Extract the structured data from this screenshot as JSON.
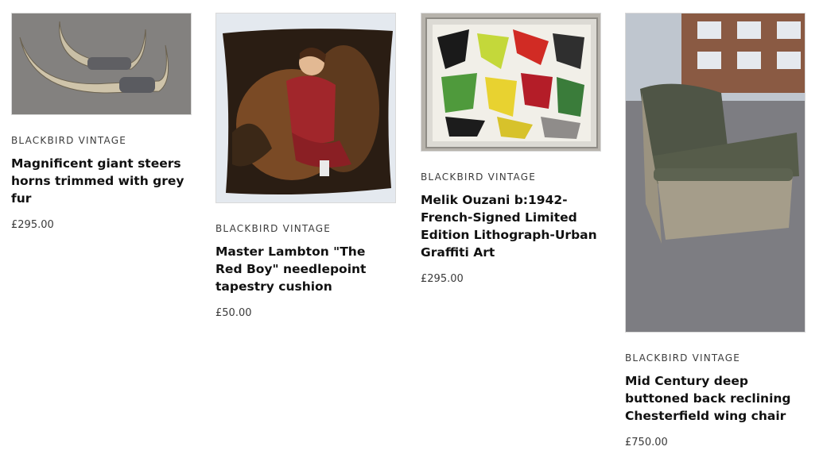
{
  "products": [
    {
      "vendor": "BLACKBIRD VINTAGE",
      "title": "Magnificent giant steers horns trimmed with grey fur",
      "price": "£295.00",
      "image_icon": "steer-horns-photo"
    },
    {
      "vendor": "BLACKBIRD VINTAGE",
      "title": "Master Lambton \"The Red Boy\" needlepoint tapestry cushion",
      "price": "£50.00",
      "image_icon": "tapestry-cushion-photo"
    },
    {
      "vendor": "BLACKBIRD VINTAGE",
      "title": "Melik Ouzani b:1942-French-Signed Limited Edition Lithograph-Urban Graffiti Art",
      "price": "£295.00",
      "image_icon": "graffiti-lithograph-photo"
    },
    {
      "vendor": "BLACKBIRD VINTAGE",
      "title": "Mid Century deep buttoned back reclining Chesterfield wing chair",
      "price": "£750.00",
      "image_icon": "chesterfield-chair-photo"
    }
  ]
}
